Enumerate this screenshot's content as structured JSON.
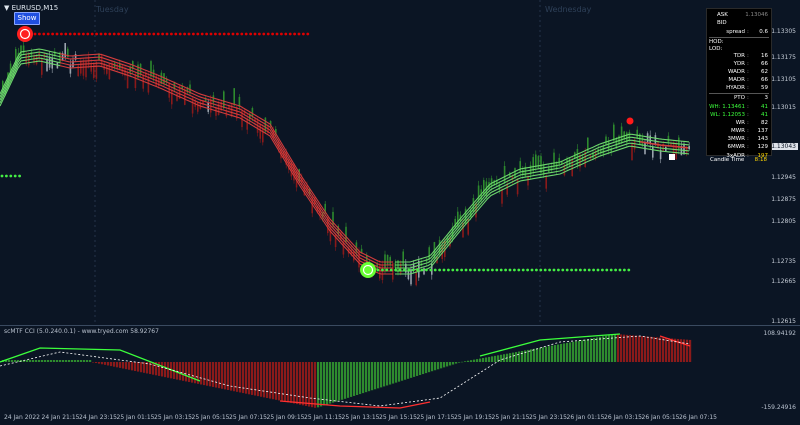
{
  "window": {
    "symbol_label": "▼ EURUSD,M15"
  },
  "toolbar": {
    "show_label": "Show"
  },
  "days": {
    "tuesday": "Tuesday",
    "wednesday": "Wednesday"
  },
  "price_axis": [
    "1.13305",
    "1.13175",
    "1.13105",
    "1.13015",
    "1.12945",
    "1.12875",
    "1.12805",
    "1.12735",
    "1.12665",
    "1.12615"
  ],
  "current_price": "1.13043",
  "info_panel": {
    "ask_label": "ASK",
    "ask_value": "1.13046",
    "bid_label": "BID",
    "spread_label": "spread",
    "spread_value": "0.6",
    "hod_label": "HOD:",
    "lod_label": "LOD:",
    "rows": [
      {
        "label": "TDR",
        "value": "16"
      },
      {
        "label": "YDR",
        "value": "66"
      },
      {
        "label": "WADR",
        "value": "62"
      },
      {
        "label": "MADR",
        "value": "66"
      },
      {
        "label": "HYADR",
        "value": "59"
      }
    ],
    "pto_label": "PTO",
    "pto_value": "3",
    "wh_label": "WH: 1.13461",
    "wh_value": "41",
    "wl_label": "WL: 1.12053",
    "wl_value": "41",
    "wr_label": "WR",
    "wr_value": "82",
    "rows2": [
      {
        "label": "MWR",
        "value": "137"
      },
      {
        "label": "3MWR",
        "value": "143"
      },
      {
        "label": "6MWR",
        "value": "129"
      }
    ],
    "adr3_label": "3xADR",
    "adr3_value": "197",
    "candle_label": "Candle Time",
    "candle_value": "8:18",
    "colors": {
      "up": "#3cff3c",
      "down": "#ff4040",
      "gold": "#ffd700"
    }
  },
  "cci_panel": {
    "title": "scMTF CCI (5.0.240.0.1) - www.tryed.com 58.92767",
    "upper_label": "108.94192",
    "lower_label": "-159.24916"
  },
  "time_axis": [
    "24 Jan 2022",
    "24 Jan 21:15",
    "24 Jan 23:15",
    "25 Jan 01:15",
    "25 Jan 03:15",
    "25 Jan 05:15",
    "25 Jan 07:15",
    "25 Jan 09:15",
    "25 Jan 11:15",
    "25 Jan 13:15",
    "25 Jan 15:15",
    "25 Jan 17:15",
    "25 Jan 19:15",
    "25 Jan 21:15",
    "25 Jan 23:15",
    "26 Jan 01:15",
    "26 Jan 03:15",
    "26 Jan 05:15",
    "26 Jan 07:15"
  ],
  "markers": {
    "c_top": "C",
    "c_bottom": "C"
  },
  "colors": {
    "background": "#0b1524",
    "bull": "#2e8b2e",
    "bear": "#8b1a1a",
    "ribbon_red": "#d23c3c",
    "ribbon_green": "#6cd66c",
    "dots_red": "#e00000",
    "dots_green": "#44ee44"
  }
}
